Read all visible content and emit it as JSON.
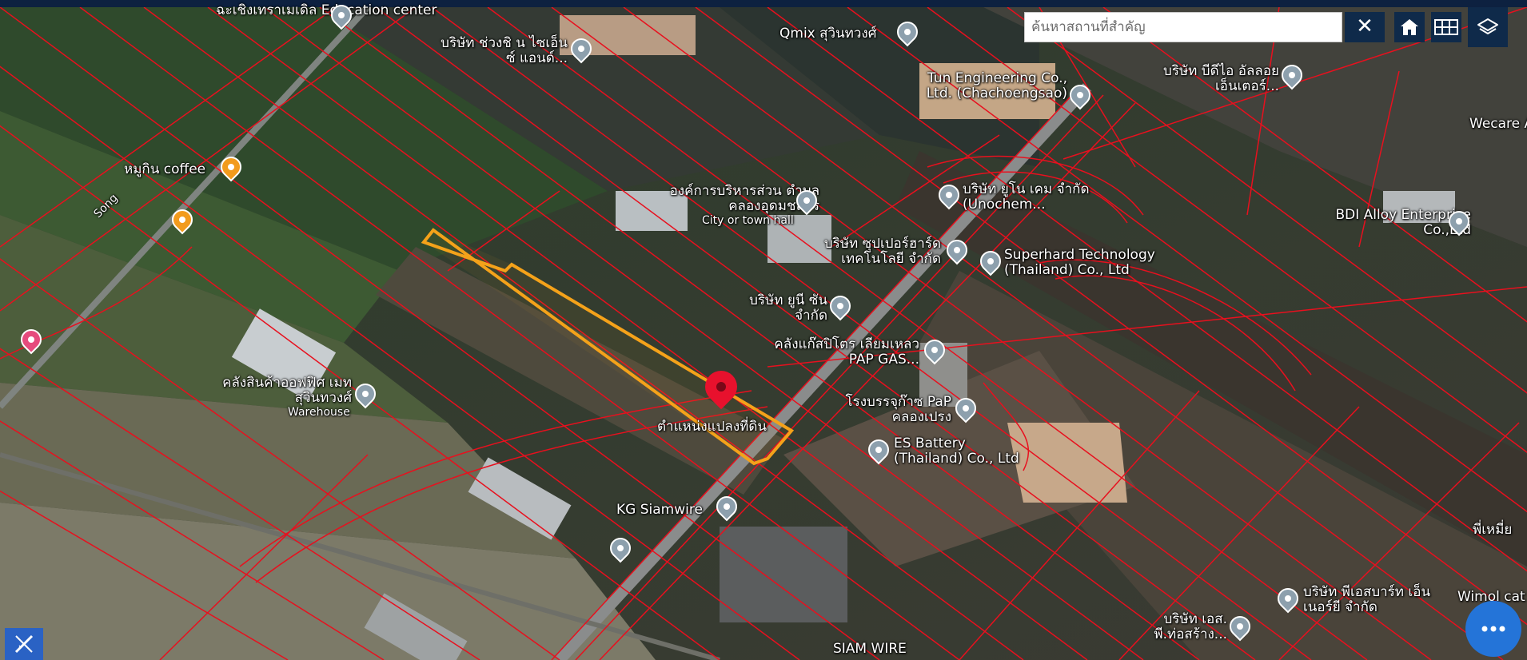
{
  "search": {
    "placeholder": "ค้นหาสถานที่สำคัญ",
    "clear_label": "✕"
  },
  "toolbar": {
    "home_icon": "home-icon",
    "grid_icon": "grid-icon",
    "layers_icon": "layers-icon"
  },
  "colors": {
    "parcel_lines": "#e8101e",
    "selected_parcel": "#f5a21a",
    "toolbar_bg": "#0f2a4a",
    "fab": "#2474d8",
    "marker": "#e8112d"
  },
  "map": {
    "selected_parcel_label": "ตำแหน่งแปลงที่ดิน",
    "places": [
      {
        "label": "ฉะเชิงเทราเมเดิล Education center"
      },
      {
        "label": "บริษัท ช่วงชิ น ไซเอ็นซ์ แอนด์..."
      },
      {
        "label": "Qmix สุวินทวงศ์"
      },
      {
        "label": "Tun Engineering Co., Ltd. (Chachoengsao)"
      },
      {
        "label": "บริษัท บีดีไอ อัลลอย เอ็นเตอร์..."
      },
      {
        "label": "Wecare Ap"
      },
      {
        "label": "หมูกิน coffee"
      },
      {
        "label": "Song"
      },
      {
        "label": "องค์การบริหารส่วน ตำบลคลองอุดมชลจร"
      },
      {
        "label": "City or town hall"
      },
      {
        "label": "บริษัท ยูโน เคม จำกัด (Unochem..."
      },
      {
        "label": "BDI Alloy Enterprise Co.,Ltd"
      },
      {
        "label": "บริษัท ซุปเปอร์ฮาร์ด เทคโนโลยี จำกัด"
      },
      {
        "label": "Superhard Technology (Thailand) Co., Ltd"
      },
      {
        "label": "บริษัท ยูนี ซัน จำกัด"
      },
      {
        "label": "คลังแก๊สปิโตร เลียมเหลว PAP GAS..."
      },
      {
        "label": "คลังสินค้าออฟฟิศ เมท สุวินทวงศ์"
      },
      {
        "label": "Warehouse"
      },
      {
        "label": "โรงบรรจุก๊าซ PaP คลองเปรง"
      },
      {
        "label": "ES Battery (Thailand) Co., Ltd"
      },
      {
        "label": "KG Siamwire"
      },
      {
        "label": "SIAM WIRE"
      },
      {
        "label": "บริษัท เอส. พี.ท่อสร้าง..."
      },
      {
        "label": "บริษัท พีเอสบาร์ท เอ็นเนอร์ยี จำกัด"
      },
      {
        "label": "พี่เหมี่ย"
      },
      {
        "label": "Wimol cat"
      }
    ]
  }
}
